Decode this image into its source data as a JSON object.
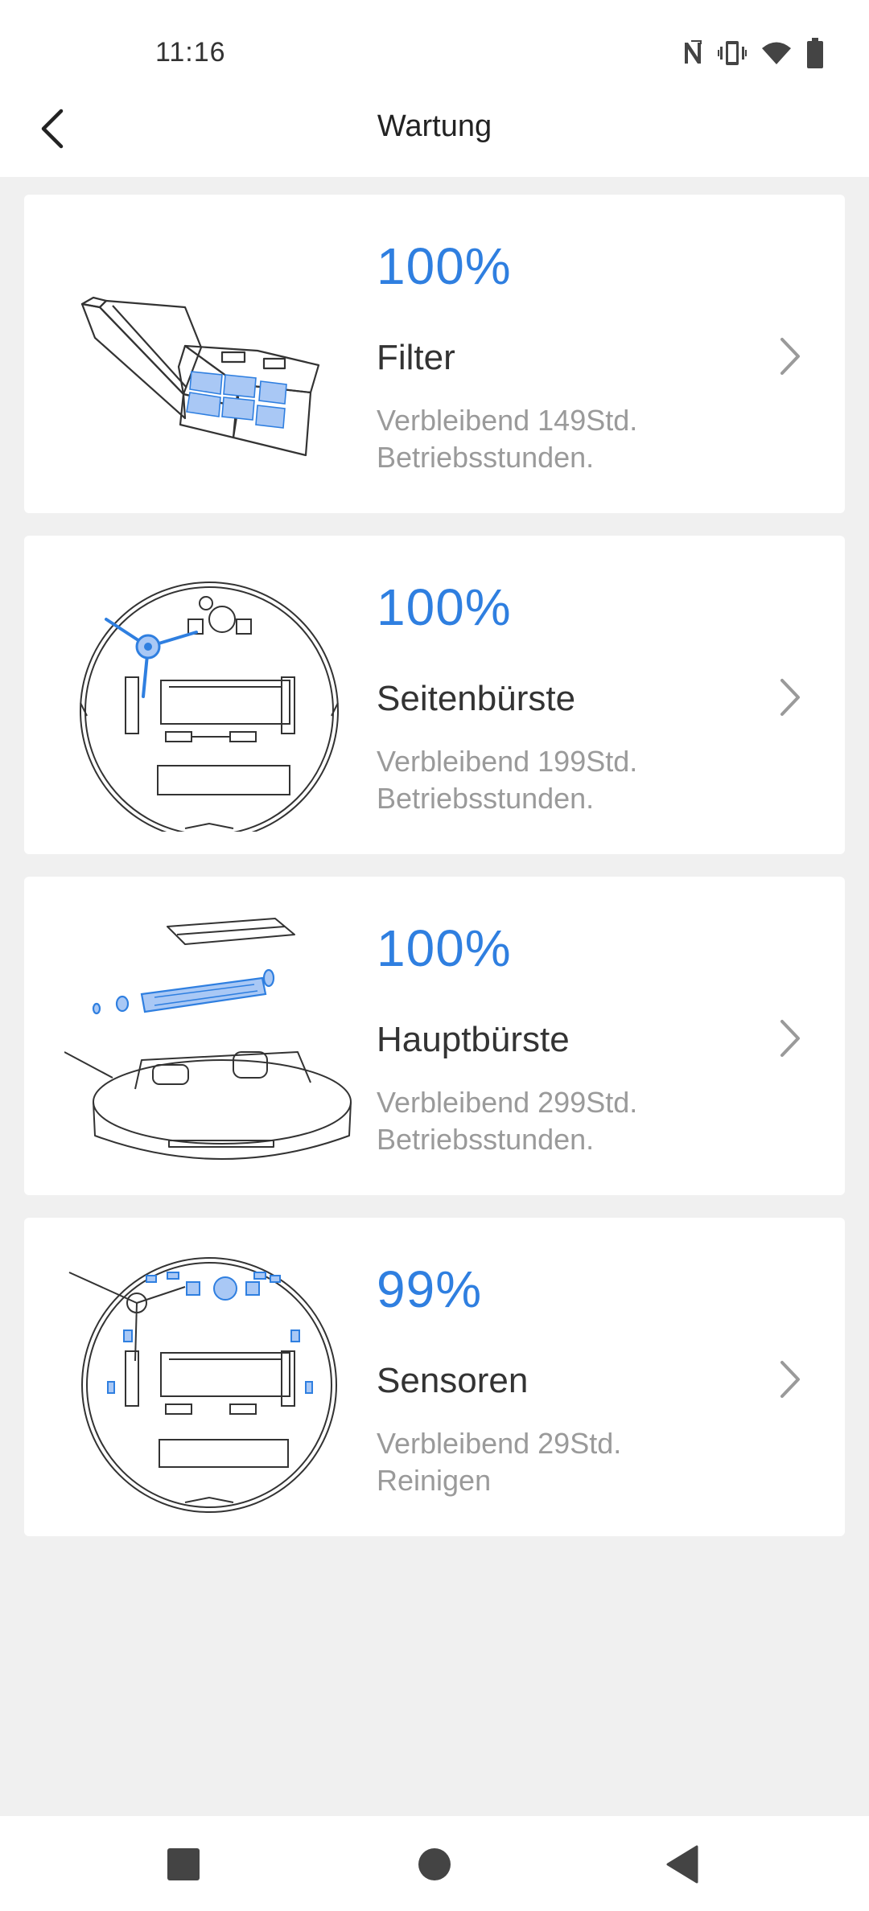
{
  "status_bar": {
    "time": "11:16",
    "icons": [
      "nfc-icon",
      "vibrate-icon",
      "wifi-icon",
      "battery-icon"
    ]
  },
  "header": {
    "title": "Wartung",
    "back_icon": "back-arrow-icon"
  },
  "items": [
    {
      "percent": "100%",
      "name": "Filter",
      "remaining_line1": "Verbleibend 149Std.",
      "remaining_line2": "Betriebsstunden.",
      "illustration": "filter-illustration"
    },
    {
      "percent": "100%",
      "name": "Seitenbürste",
      "remaining_line1": "Verbleibend 199Std.",
      "remaining_line2": "Betriebsstunden.",
      "illustration": "side-brush-illustration"
    },
    {
      "percent": "100%",
      "name": "Hauptbürste",
      "remaining_line1": "Verbleibend 299Std.",
      "remaining_line2": "Betriebsstunden.",
      "illustration": "main-brush-illustration"
    },
    {
      "percent": "99%",
      "name": "Sensoren",
      "remaining_line1": "Verbleibend 29Std.",
      "remaining_line2": "Reinigen",
      "illustration": "sensor-illustration"
    }
  ],
  "nav_bar": {
    "buttons": [
      "recents-square-icon",
      "home-circle-icon",
      "back-triangle-icon"
    ]
  },
  "colors": {
    "accent": "#2f7fe0",
    "background": "#f0f0f0",
    "card": "#ffffff",
    "secondary_text": "#9a9a9a",
    "illustration_blue": "#a9c8f5"
  }
}
